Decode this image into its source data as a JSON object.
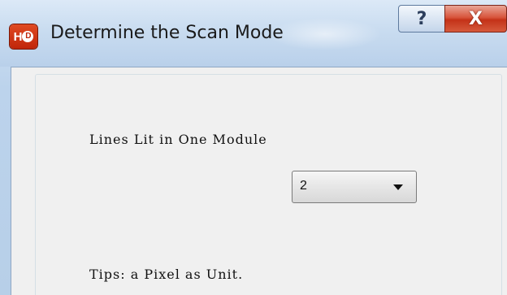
{
  "window": {
    "title": "Determine the Scan Mode",
    "app_icon_text": "H",
    "app_icon_bubble": "D",
    "help_label": "?",
    "close_label": "X"
  },
  "form": {
    "lines_label": "Lines Lit in One Module",
    "lines_value": "2",
    "tips": "Tips: a Pixel as Unit."
  },
  "icons": {
    "app": "hd-logo-icon",
    "help": "help-icon",
    "close": "close-icon",
    "dropdown": "chevron-down-icon"
  },
  "colors": {
    "close_button": "#c43218",
    "title_bar": "#c9dcf0",
    "client_background": "#f0f0f0"
  }
}
